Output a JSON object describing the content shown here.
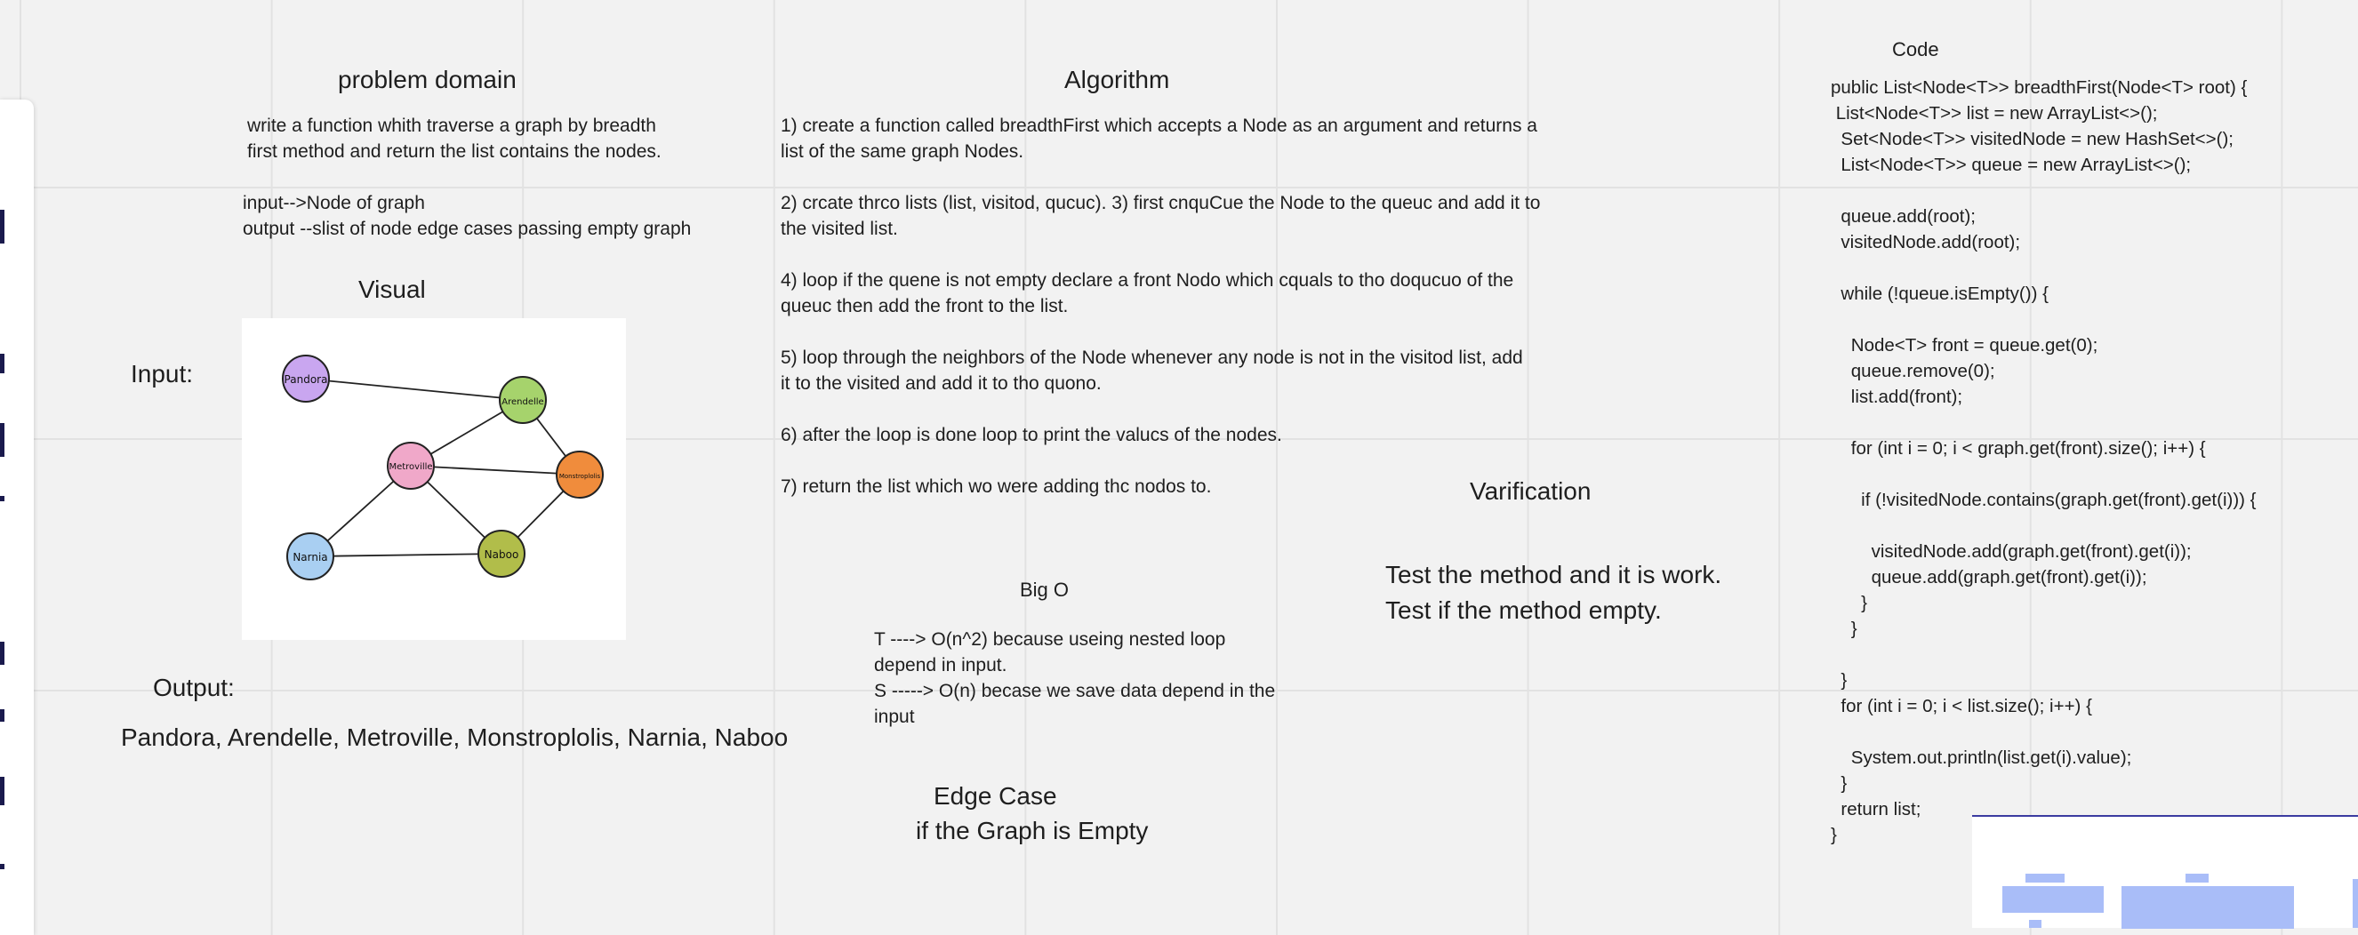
{
  "problem_domain": {
    "title": "problem domain",
    "description": "write a function whith traverse a graph by breadth\nfirst method and return the list contains the nodes.",
    "io": "input-->Node of graph\noutput --slist of node edge cases passing empty graph"
  },
  "visual": {
    "title": "Visual",
    "input_label": "Input:",
    "output_label": "Output:",
    "output_value": "Pandora, Arendelle, Metroville, Monstroplolis, Narnia, Naboo",
    "nodes": [
      {
        "label": "Pandora",
        "color": "#c9a6f0"
      },
      {
        "label": "Arendelle",
        "color": "#a6d36c"
      },
      {
        "label": "Metroville",
        "color": "#f0a8c9"
      },
      {
        "label": "Monstroplolis",
        "color": "#f08c3c"
      },
      {
        "label": "Narnia",
        "color": "#a9cff2"
      },
      {
        "label": "Naboo",
        "color": "#b1bd4a"
      }
    ]
  },
  "algorithm": {
    "title": "Algorithm",
    "text": "1) create a function called breadthFirst which accepts a Node as an argument and returns a\nlist of the same graph Nodes.\n\n2) crcate thrco lists (list, visitod, qucuc). 3) first cnquCue the Node to the queuc and add it to\nthe visited list.\n\n4) loop if the quene is not empty declare a front Nodo which cquals to tho doqucuo of the\nqueuc then add the front to the list.\n\n5) loop through the neighbors of the Node whenever any node is not in the visitod list, add\nit to the visited and add it to tho quono.\n\n6) after the loop is done loop to print the valucs of the nodes.\n\n7) return the list which wo were adding thc nodos to."
  },
  "big_o": {
    "title": "Big O",
    "text": "T ----> O(n^2) because useing nested loop\ndepend in input.\nS -----> O(n) becase we save data depend in the\ninput"
  },
  "edge_case": {
    "title": "Edge Case",
    "text": "if the Graph is Empty"
  },
  "verification": {
    "title": "Varification",
    "text": "Test the method and it is work.\nTest if the method empty."
  },
  "code": {
    "title": "Code",
    "text": "public List<Node<T>> breadthFirst(Node<T> root) {\n List<Node<T>> list = new ArrayList<>();\n  Set<Node<T>> visitedNode = new HashSet<>();\n  List<Node<T>> queue = new ArrayList<>();\n\n  queue.add(root);\n  visitedNode.add(root);\n\n  while (!queue.isEmpty()) {\n\n    Node<T> front = queue.get(0);\n    queue.remove(0);\n    list.add(front);\n\n    for (int i = 0; i < graph.get(front).size(); i++) {\n\n      if (!visitedNode.contains(graph.get(front).get(i))) {\n\n        visitedNode.add(graph.get(front).get(i));\n        queue.add(graph.get(front).get(i));\n      }\n    }\n\n  }\n  for (int i = 0; i < list.size(); i++) {\n\n    System.out.println(list.get(i).value);\n  }\n  return list;\n}"
  }
}
